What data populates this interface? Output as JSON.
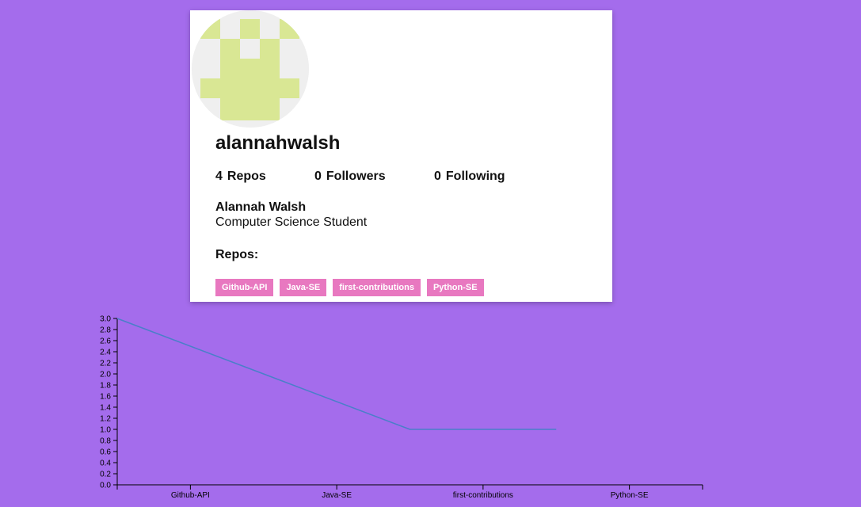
{
  "profile": {
    "username": "alannahwalsh",
    "stats": {
      "repos_count": "4",
      "repos_label": "Repos",
      "followers_count": "0",
      "followers_label": "Followers",
      "following_count": "0",
      "following_label": "Following"
    },
    "name": "Alannah Walsh",
    "bio": "Computer Science Student",
    "repos_heading": "Repos:",
    "repos": [
      "Github-API",
      "Java-SE",
      "first-contributions",
      "Python-SE"
    ]
  },
  "colors": {
    "background": "#a46cec",
    "card": "#ffffff",
    "tag": "#e878c0",
    "avatar_fg": "#d9e794",
    "avatar_bg": "#efefef",
    "line": "#4a7fc9"
  },
  "chart_data": {
    "type": "line",
    "categories": [
      "Github-API",
      "Java-SE",
      "first-contributions",
      "Python-SE"
    ],
    "x": [
      "Github-API",
      "Java-SE",
      "first-contributions",
      "Python-SE"
    ],
    "values": [
      3,
      2,
      1,
      1
    ],
    "y_ticks": [
      "0.0",
      "0.2",
      "0.4",
      "0.6",
      "0.8",
      "1.0",
      "1.2",
      "1.4",
      "1.6",
      "1.8",
      "2.0",
      "2.2",
      "2.4",
      "2.6",
      "2.8",
      "3.0"
    ],
    "ylim": [
      0,
      3
    ],
    "title": "",
    "xlabel": "",
    "ylabel": "",
    "grid": false
  }
}
